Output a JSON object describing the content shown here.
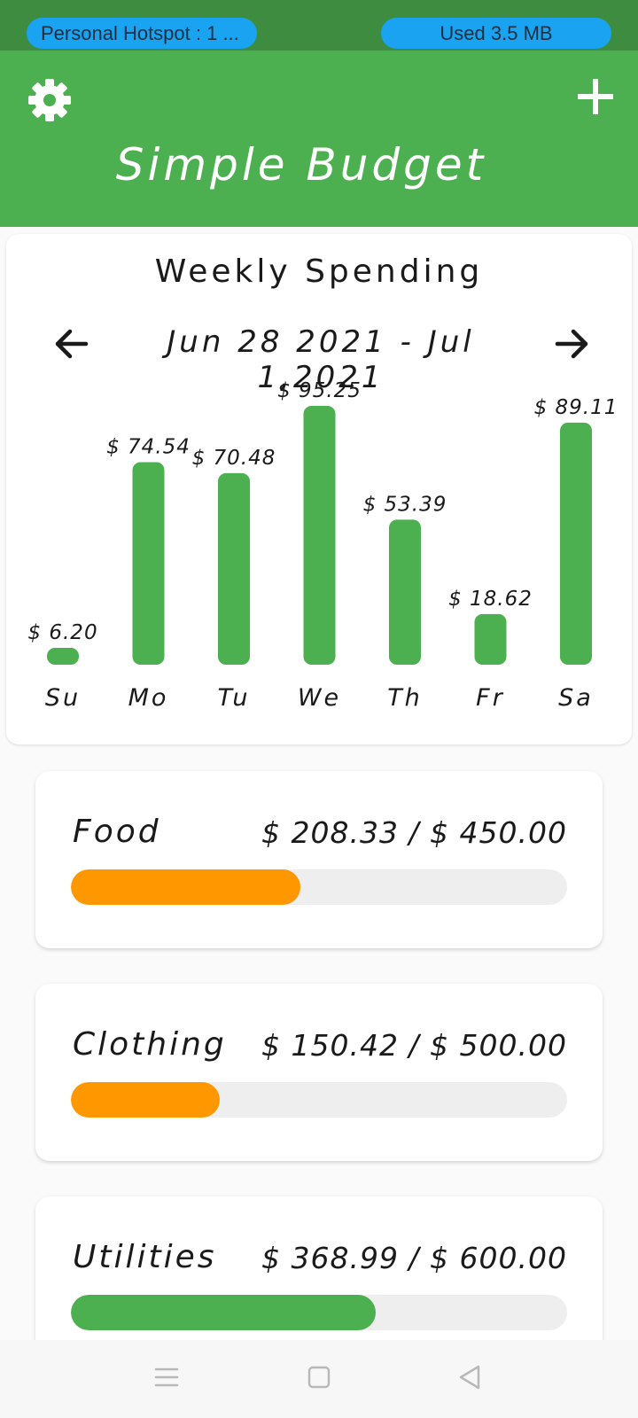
{
  "status_bar": {
    "hotspot_label": "Personal Hotspot : 1 ...",
    "data_usage": "Used  3.5 MB"
  },
  "app_bar": {
    "title": "Simple Budget",
    "settings_icon": "gear-icon",
    "add_icon": "plus-icon"
  },
  "weekly": {
    "title": "Weekly Spending",
    "date_range": "Jun 28 2021 - Jul 1,2021",
    "prev_icon": "arrow-left-icon",
    "next_icon": "arrow-right-icon"
  },
  "chart_data": {
    "type": "bar",
    "categories": [
      "Su",
      "Mo",
      "Tu",
      "We",
      "Th",
      "Fr",
      "Sa"
    ],
    "values": [
      6.2,
      74.54,
      70.48,
      95.25,
      53.39,
      18.62,
      89.11
    ],
    "value_labels": [
      "$ 6.20",
      "$ 74.54",
      "$ 70.48",
      "$ 95.25",
      "$ 53.39",
      "$ 18.62",
      "$ 89.11"
    ],
    "title": "Weekly Spending",
    "xlabel": "",
    "ylabel": "",
    "ylim": [
      0,
      95.25
    ],
    "grid": false,
    "bar_color": "#4caf50"
  },
  "budgets": [
    {
      "name": "Food",
      "amount": "$ 208.33 / $ 450.00",
      "spent": 208.33,
      "limit": 450.0,
      "color": "#ff9800"
    },
    {
      "name": "Clothing",
      "amount": "$ 150.42 / $ 500.00",
      "spent": 150.42,
      "limit": 500.0,
      "color": "#ff9800"
    },
    {
      "name": "Utilities",
      "amount": "$ 368.99 / $ 600.00",
      "spent": 368.99,
      "limit": 600.0,
      "color": "#4caf50"
    }
  ],
  "nav": {
    "menu_icon": "menu-icon",
    "home_icon": "square-home-icon",
    "back_icon": "triangle-back-icon"
  },
  "colors": {
    "status_bar": "#3d8c40",
    "app_bar": "#4caf50",
    "pill": "#1aa3f0",
    "track": "#eeeeee"
  }
}
